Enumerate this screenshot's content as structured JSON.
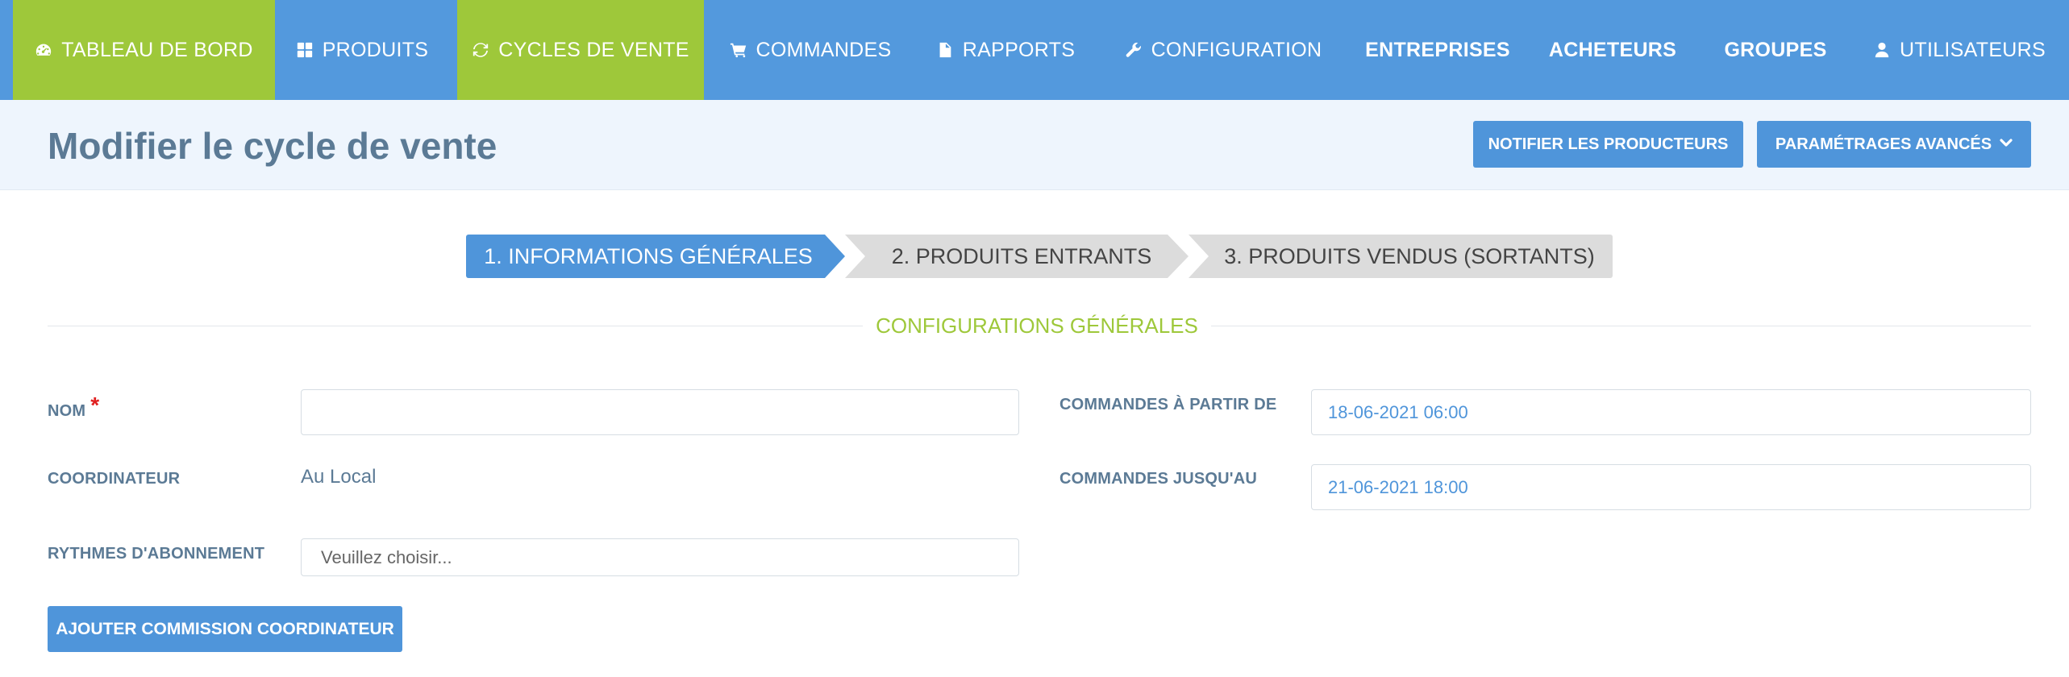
{
  "nav": {
    "items": [
      {
        "label": "TABLEAU DE BORD",
        "icon": "dashboard-icon",
        "active": true
      },
      {
        "label": "PRODUITS",
        "icon": "grid-icon",
        "active": false
      },
      {
        "label": "CYCLES DE VENTE",
        "icon": "refresh-icon",
        "active": true
      },
      {
        "label": "COMMANDES",
        "icon": "cart-icon",
        "active": false
      },
      {
        "label": "RAPPORTS",
        "icon": "document-icon",
        "active": false
      },
      {
        "label": "CONFIGURATION",
        "icon": "wrench-icon",
        "active": false
      },
      {
        "label": "ENTREPRISES",
        "icon": null,
        "active": false
      },
      {
        "label": "ACHETEURS",
        "icon": null,
        "active": false
      },
      {
        "label": "GROUPES",
        "icon": null,
        "active": false
      },
      {
        "label": "UTILISATEURS",
        "icon": "user-icon",
        "active": false
      }
    ],
    "colors": {
      "bar": "#5399dd",
      "active": "#9ec83a"
    }
  },
  "header": {
    "title": "Modifier le cycle de vente",
    "notify_button": "NOTIFIER LES PRODUCTEURS",
    "advanced_button": "PARAMÉTRAGES AVANCÉS"
  },
  "wizard": {
    "steps": [
      {
        "label": "1. INFORMATIONS GÉNÉRALES",
        "active": true
      },
      {
        "label": "2. PRODUITS ENTRANTS",
        "active": false
      },
      {
        "label": "3. PRODUITS VENDUS (SORTANTS)",
        "active": false
      }
    ]
  },
  "section": {
    "title": "CONFIGURATIONS GÉNÉRALES"
  },
  "form": {
    "nom": {
      "label": "NOM",
      "required_mark": "*",
      "value": ""
    },
    "coordinateur": {
      "label": "COORDINATEUR",
      "value": "Au Local"
    },
    "rythmes": {
      "label": "RYTHMES D'ABONNEMENT",
      "placeholder": "Veuillez choisir..."
    },
    "commandes_debut": {
      "label": "COMMANDES À PARTIR DE",
      "value": "18-06-2021 06:00"
    },
    "commandes_fin": {
      "label": "COMMANDES JUSQU'AU",
      "value": "21-06-2021 18:00"
    },
    "add_commission_button": "AJOUTER COMMISSION COORDINATEUR"
  }
}
